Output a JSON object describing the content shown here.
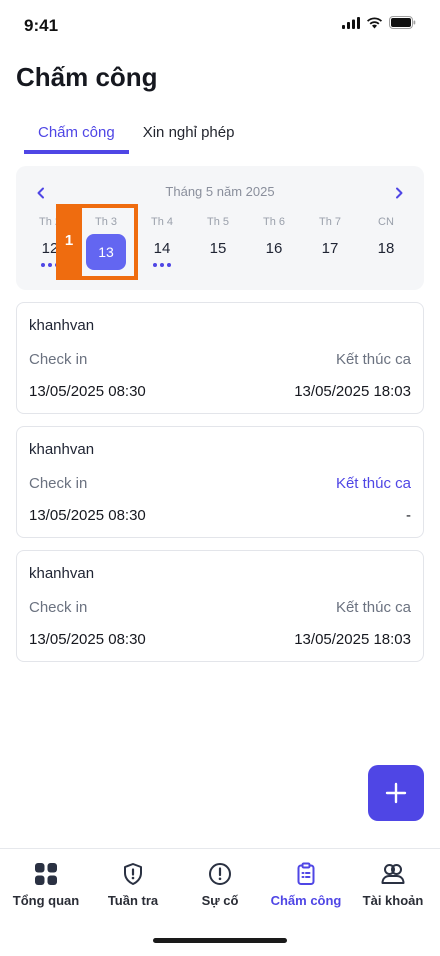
{
  "status": {
    "time": "9:41"
  },
  "page": {
    "title": "Chấm công"
  },
  "tabs": [
    {
      "label": "Chấm công",
      "active": true
    },
    {
      "label": "Xin nghỉ phép",
      "active": false
    }
  ],
  "calendar": {
    "month_label": "Tháng 5 năm 2025",
    "days": [
      {
        "dow": "Th 2",
        "date": "12",
        "dots": 3
      },
      {
        "dow": "Th 3",
        "date": "13",
        "selected": true
      },
      {
        "dow": "Th 4",
        "date": "14",
        "dots": 3
      },
      {
        "dow": "Th 5",
        "date": "15"
      },
      {
        "dow": "Th 6",
        "date": "16"
      },
      {
        "dow": "Th 7",
        "date": "17"
      },
      {
        "dow": "CN",
        "date": "18"
      }
    ]
  },
  "highlight": {
    "label": "1"
  },
  "records": [
    {
      "name": "khanhvan",
      "check_in_label": "Check in",
      "end_label": "Kết thúc ca",
      "check_in": "13/05/2025 08:30",
      "end": "13/05/2025 18:03"
    },
    {
      "name": "khanhvan",
      "check_in_label": "Check in",
      "end_label": "Kết thúc ca",
      "check_in": "13/05/2025 08:30",
      "end": "-"
    },
    {
      "name": "khanhvan",
      "check_in_label": "Check in",
      "end_label": "Kết thúc ca",
      "check_in": "13/05/2025 08:30",
      "end": "13/05/2025 18:03"
    }
  ],
  "bottom_nav": [
    {
      "label": "Tổng quan",
      "icon": "grid-icon"
    },
    {
      "label": "Tuần tra",
      "icon": "shield-alert-icon"
    },
    {
      "label": "Sự cố",
      "icon": "alert-circle-icon"
    },
    {
      "label": "Chấm công",
      "icon": "clipboard-icon",
      "active": true
    },
    {
      "label": "Tài khoản",
      "icon": "users-icon"
    }
  ],
  "colors": {
    "accent": "#4f46e5",
    "highlight": "#ef6c0f"
  }
}
